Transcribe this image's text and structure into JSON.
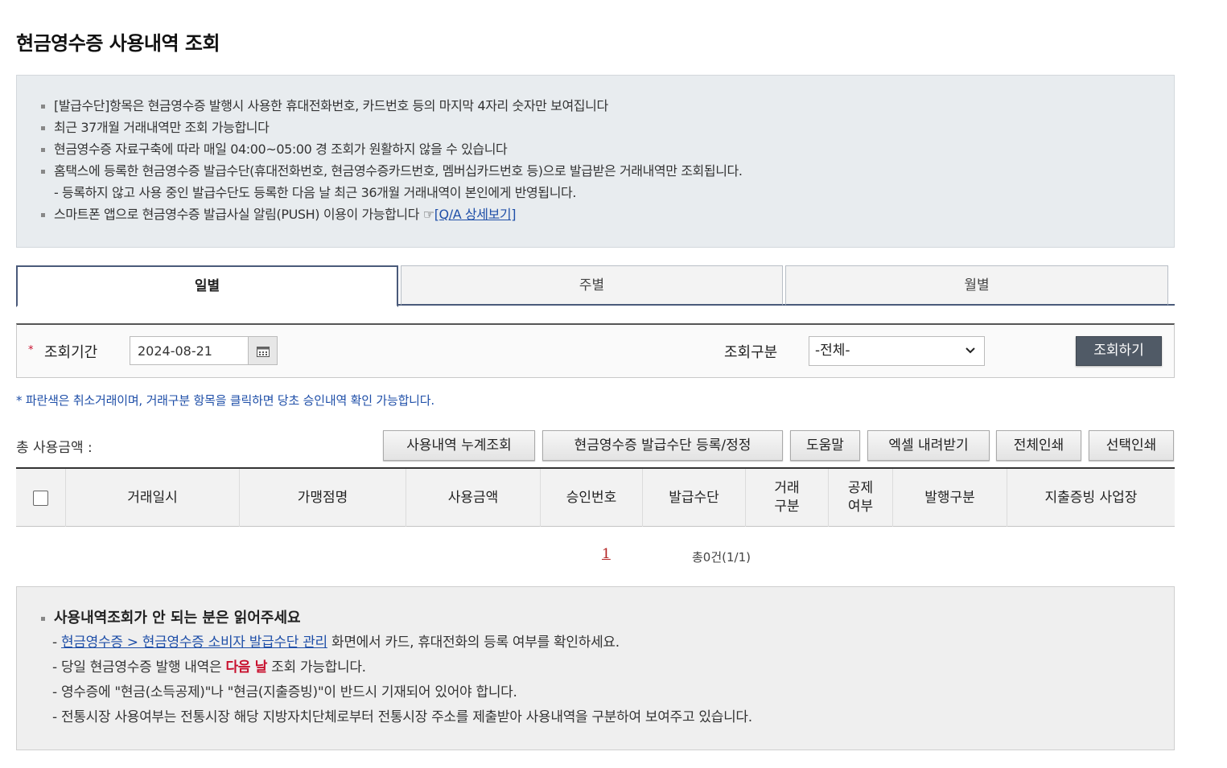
{
  "page": {
    "title": "현금영수증 사용내역 조회"
  },
  "notices": {
    "line1": "[발급수단]항목은 현금영수증 발행시 사용한 휴대전화번호, 카드번호 등의 마지막 4자리 숫자만 보여집니다",
    "line2": "최근 37개월 거래내역만 조회 가능합니다",
    "line3": "현금영수증 자료구축에 따라 매일 04:00~05:00 경 조회가 원활하지 않을 수 있습니다",
    "line4": "홈택스에 등록한 현금영수증 발급수단(휴대전화번호, 현금영수증카드번호, 멤버십카드번호 등)으로 발급받은 거래내역만 조회됩니다.",
    "line4_sub": "- 등록하지 않고 사용 중인 발급수단도 등록한 다음 날 최근 36개월 거래내역이 본인에게 반영됩니다.",
    "line5": "스마트폰 앱으로 현금영수증 발급사실 알림(PUSH) 이용이 가능합니다 ☞",
    "line5_link": "[Q/A 상세보기]"
  },
  "tabs": {
    "daily": "일별",
    "weekly": "주별",
    "monthly": "월별"
  },
  "search": {
    "required_mark": "*",
    "period_label": "조회기간",
    "date_value": "2024-08-21",
    "type_label": "조회구분",
    "type_selected": "-전체-",
    "submit_label": "조회하기"
  },
  "hint": "* 파란색은 취소거래이며, 거래구분 항목을 클릭하면 당초 승인내역 확인 가능합니다.",
  "summary": {
    "total_label": "총 사용금액 :"
  },
  "actions": {
    "cumulative": "사용내역 누계조회",
    "register": "현금영수증 발급수단 등록/정정",
    "help": "도움말",
    "excel": "엑셀 내려받기",
    "print_all": "전체인쇄",
    "print_selected": "선택인쇄"
  },
  "table": {
    "col_datetime": "거래일시",
    "col_merchant": "가맹점명",
    "col_amount": "사용금액",
    "col_approval": "승인번호",
    "col_issue_means": "발급수단",
    "col_trade_type_1": "거래",
    "col_trade_type_2": "구분",
    "col_deduction_1": "공제",
    "col_deduction_2": "여부",
    "col_issue_type": "발행구분",
    "col_business": "지출증빙 사업장"
  },
  "pager": {
    "current_page": "1",
    "count_text": "총0건(1/1)"
  },
  "help": {
    "title": "사용내역조회가 안 되는 분은 읽어주세요",
    "l1_prefix": "- ",
    "l1_link": "현금영수증 > 현금영수증 소비자 발급수단 관리",
    "l1_suffix": " 화면에서 카드, 휴대전화의 등록 여부를 확인하세요.",
    "l2_prefix": "- 당일 현금영수증 발행 내역은 ",
    "l2_red": "다음 날",
    "l2_suffix": " 조회 가능합니다.",
    "l3": "- 영수증에 \"현금(소득공제)\"나 \"현금(지출증빙)\"이 반드시 기재되어 있어야 합니다.",
    "l4": "- 전통시장 사용여부는 전통시장 해당 지방자치단체로부터 전통시장 주소를 제출받아 사용내역을 구분하여 보여주고 있습니다."
  },
  "colors": {
    "accent_blue": "#1f4fa8",
    "alert_red": "#c8102e",
    "button_dark": "#505a66"
  },
  "icons": {
    "calendar": "calendar-icon",
    "dropdown": "chevron-down-icon"
  }
}
